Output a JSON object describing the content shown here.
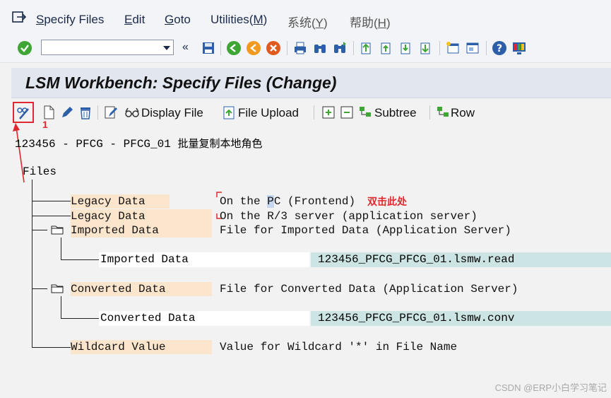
{
  "menu": {
    "items": [
      {
        "pre": "",
        "key": "S",
        "post": "pecify Files"
      },
      {
        "pre": "",
        "key": "E",
        "post": "dit"
      },
      {
        "pre": "",
        "key": "G",
        "post": "oto"
      },
      {
        "pre": "Utilities(",
        "key": "M",
        "post": ")"
      },
      {
        "pre": "系统(",
        "key": "Y",
        "post": ")"
      },
      {
        "pre": "帮助(",
        "key": "H",
        "post": ")"
      }
    ]
  },
  "toolbar": {
    "command_field_value": ""
  },
  "title": "LSM Workbench: Specify Files (Change)",
  "app_toolbar": {
    "display_file": "Display File",
    "file_upload": "File Upload",
    "subtree": "Subtree",
    "row": "Row"
  },
  "annotations": {
    "step_number": "1",
    "double_click_hint": "双击此处"
  },
  "header": {
    "project": "123456 - PFCG - PFCG_01",
    "description": "批量复制本地角色"
  },
  "tree": {
    "root": "Files",
    "legacy_frontend": {
      "label": "Legacy Data",
      "desc_pre": "On the ",
      "desc_hl": "P",
      "desc_post": "C (Frontend)"
    },
    "legacy_server": {
      "label": "Legacy Data",
      "desc": "On the R/3 server (application server)"
    },
    "imported": {
      "label": "Imported Data",
      "desc": "File for Imported Data (Application Server)",
      "child_label": "Imported Data",
      "child_value": "123456_PFCG_PFCG_01.lsmw.read"
    },
    "converted": {
      "label": "Converted Data",
      "desc": "File for Converted Data (Application Server)",
      "child_label": "Converted Data",
      "child_value": "123456_PFCG_PFCG_01.lsmw.conv"
    },
    "wildcard": {
      "label": "Wildcard Value",
      "desc": "Value for Wildcard '*' in File Name"
    }
  },
  "watermark": "CSDN @ERP小白学习笔记",
  "colors": {
    "accent_red": "#e0282e",
    "label_bg": "#fbe5cc",
    "value_bg": "#cce4e4",
    "title_bg": "#e1e6ef"
  }
}
